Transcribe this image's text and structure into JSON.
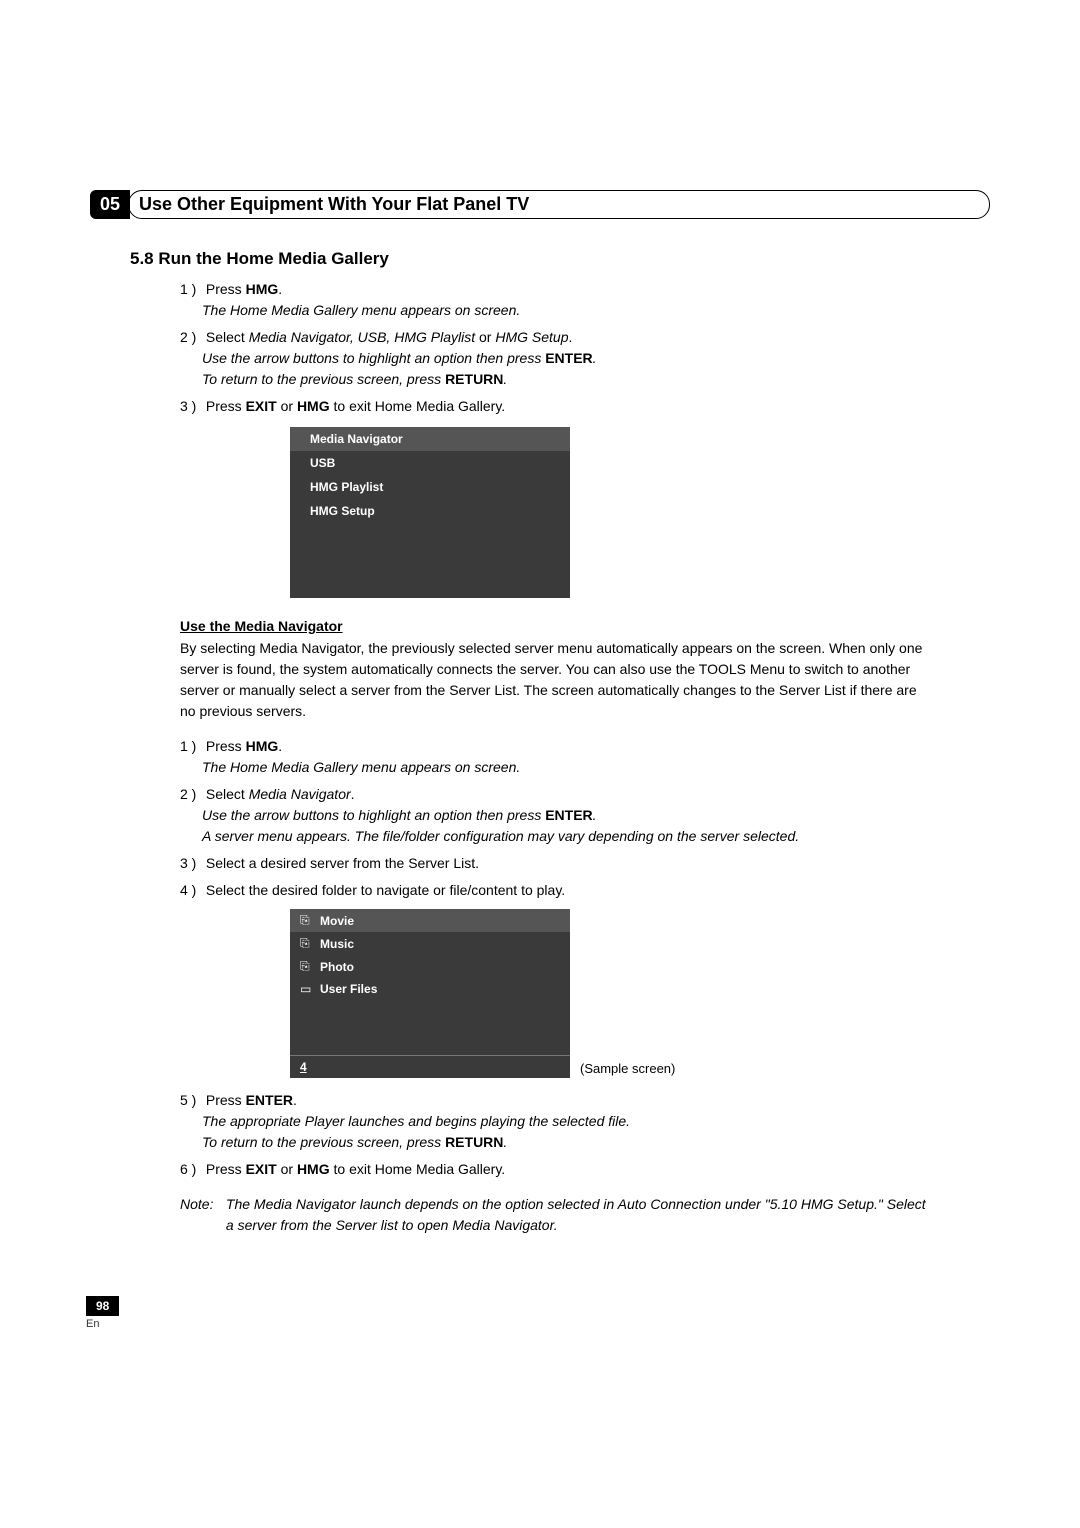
{
  "chapter": {
    "num": "05",
    "title": "Use Other Equipment With Your Flat Panel TV"
  },
  "section": {
    "title": "5.8 Run the Home Media Gallery"
  },
  "steps1": {
    "s1_num": "1 )",
    "s1_a": "Press ",
    "s1_b": "HMG",
    "s1_c": ".",
    "s1_it": "The Home Media Gallery menu appears on screen.",
    "s2_num": "2 )",
    "s2_a": "Select ",
    "s2_b": "Media Navigator, USB, HMG Playlist",
    "s2_c": " or ",
    "s2_d": "HMG Setup",
    "s2_e": ".",
    "s2_it_a": "Use the arrow buttons to highlight an option then press ",
    "s2_it_b": "ENTER",
    "s2_it_c": ".",
    "s2_it2_a": "To return to the previous screen, press ",
    "s2_it2_b": "RETURN",
    "s2_it2_c": ".",
    "s3_num": "3 )",
    "s3_a": "Press ",
    "s3_b": "EXIT",
    "s3_c": " or ",
    "s3_d": "HMG",
    "s3_e": " to exit Home Media Gallery."
  },
  "menu1": {
    "i1": "Media Navigator",
    "i2": "USB",
    "i3": "HMG Playlist",
    "i4": "HMG Setup"
  },
  "subsection": {
    "title": "Use the Media Navigator",
    "body": "By selecting Media Navigator, the previously selected server menu automatically appears on the screen. When only one server is found, the system automatically connects the server. You can also use the TOOLS Menu to switch to another server or manually select a server from the Server List. The screen automatically changes to the Server List if there are no previous servers."
  },
  "steps2": {
    "s1_num": "1 )",
    "s1_a": "Press ",
    "s1_b": "HMG",
    "s1_c": ".",
    "s1_it": "The Home Media Gallery menu appears on screen.",
    "s2_num": "2 )",
    "s2_a": "Select ",
    "s2_b": "Media Navigator",
    "s2_c": ".",
    "s2_it_a": "Use the arrow buttons to highlight an option then press ",
    "s2_it_b": "ENTER",
    "s2_it_c": ".",
    "s2_it2": "A server menu appears. The file/folder configuration may vary depending on the server selected.",
    "s3_num": "3 )",
    "s3": "Select a desired server from the Server List.",
    "s4_num": "4 )",
    "s4": "Select the desired folder to navigate or file/content to play.",
    "s5_num": "5 )",
    "s5_a": "Press ",
    "s5_b": "ENTER",
    "s5_c": ".",
    "s5_it": "The appropriate Player launches and begins playing the selected file.",
    "s5_it2_a": "To return to the previous screen, press ",
    "s5_it2_b": "RETURN",
    "s5_it2_c": ".",
    "s6_num": "6 )",
    "s6_a": "Press ",
    "s6_b": "EXIT",
    "s6_c": " or ",
    "s6_d": "HMG",
    "s6_e": " to exit Home Media Gallery."
  },
  "menu2": {
    "i1": "Movie",
    "i2": "Music",
    "i3": "Photo",
    "i4": "User Files",
    "footer": "4",
    "sample": "(Sample screen)"
  },
  "note": {
    "label": "Note:",
    "body": "The Media Navigator launch depends on the option selected in Auto Connection under \"5.10 HMG Setup.\" Select a server from the Server list to open Media Navigator."
  },
  "footer": {
    "page": "98",
    "lang": "En"
  }
}
